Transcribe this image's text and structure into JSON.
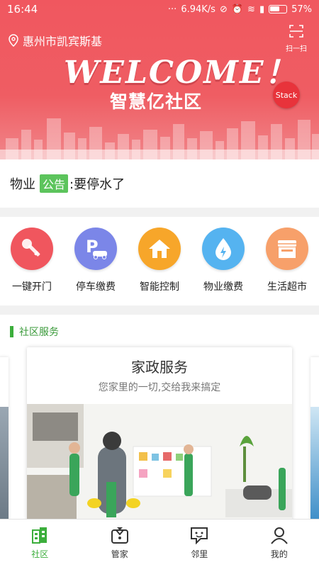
{
  "status_bar": {
    "time": "16:44",
    "network_speed": "6.94K/s",
    "battery": "57%"
  },
  "banner": {
    "location": "惠州市凯宾斯基",
    "scan_label": "扫一扫",
    "welcome": "WELCOME！",
    "subtitle": "智慧亿社区",
    "badge": "Stack",
    "colors": {
      "background": "#f0575f"
    }
  },
  "notice": {
    "lead": "物业",
    "tag": "公告",
    "text": ":要停水了"
  },
  "quick_actions": [
    {
      "label": "一键开门",
      "icon": "key-icon",
      "color": "#f0565e"
    },
    {
      "label": "停车缴费",
      "icon": "parking-icon",
      "color": "#7b86e8"
    },
    {
      "label": "智能控制",
      "icon": "home-icon",
      "color": "#f7a62a"
    },
    {
      "label": "物业缴费",
      "icon": "water-drop-icon",
      "color": "#55b3f0"
    },
    {
      "label": "生活超市",
      "icon": "store-icon",
      "color": "#f7a06a"
    }
  ],
  "services": {
    "title": "社区服务",
    "card": {
      "title": "家政服务",
      "subtitle": "您家里的一切,交给我来搞定"
    }
  },
  "tabbar": [
    {
      "label": "社区",
      "icon": "building-icon",
      "active": true
    },
    {
      "label": "管家",
      "icon": "butler-icon",
      "active": false
    },
    {
      "label": "邻里",
      "icon": "chat-icon",
      "active": false
    },
    {
      "label": "我的",
      "icon": "person-icon",
      "active": false
    }
  ],
  "colors": {
    "accent": "#3cae3c"
  }
}
